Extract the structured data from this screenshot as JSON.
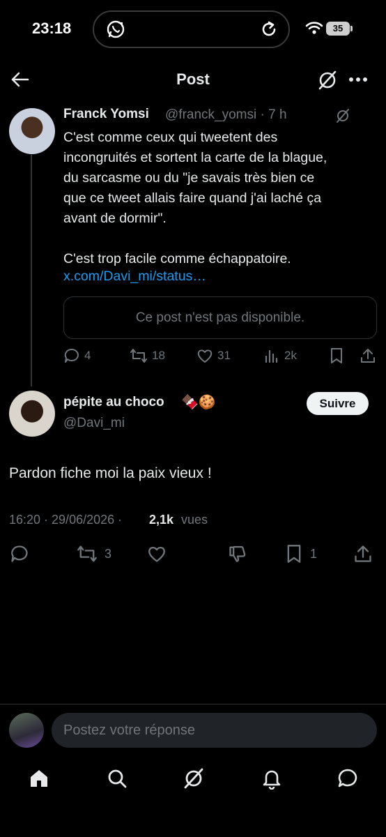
{
  "status_bar": {
    "time": "23:18",
    "battery": "35",
    "icons": [
      "whatsapp-call-icon",
      "reload-icon",
      "wifi-icon",
      "battery-icon"
    ]
  },
  "header": {
    "title": "Post",
    "icons": [
      "back-arrow-icon",
      "grok-icon",
      "more-icon"
    ]
  },
  "parent_post": {
    "author_name": "Franck Yomsi",
    "meta": "@franck_yomsi · 7 h",
    "text": "C'est comme ceux qui tweetent des\nincongruités et sortent la carte de la blague,\ndu sarcasme ou du \"je savais très bien ce\nque ce tweet allais faire quand j'ai laché ça\navant de dormir\".\n\nC'est trop facile comme échappatoire.",
    "link": "x.com/Davi_mi/status…",
    "quote_unavailable": "Ce post n'est pas disponible.",
    "actions": {
      "replies": "4",
      "reposts": "18",
      "likes": "31",
      "views": "2k"
    }
  },
  "main_post": {
    "author_name": "pépite au choco",
    "author_emoji": "🍫🍪",
    "handle": "@Davi_mi",
    "follow_label": "Suivre",
    "text": "Pardon fiche moi la paix vieux !",
    "timestamp": "16:20 · 29/06/2026 ·",
    "views_count": "2,1k",
    "views_label": "vues",
    "actions": {
      "reposts": "3",
      "bookmarks": "1"
    }
  },
  "reply_bar": {
    "placeholder": "Postez votre réponse"
  },
  "bottom_nav": [
    "home-icon",
    "search-icon",
    "grok-icon",
    "notifications-icon",
    "messages-icon"
  ],
  "colors": {
    "background": "#000000",
    "text": "#e7e9ea",
    "muted": "#71767b",
    "link": "#1d9bf0",
    "border": "#2f3336"
  }
}
